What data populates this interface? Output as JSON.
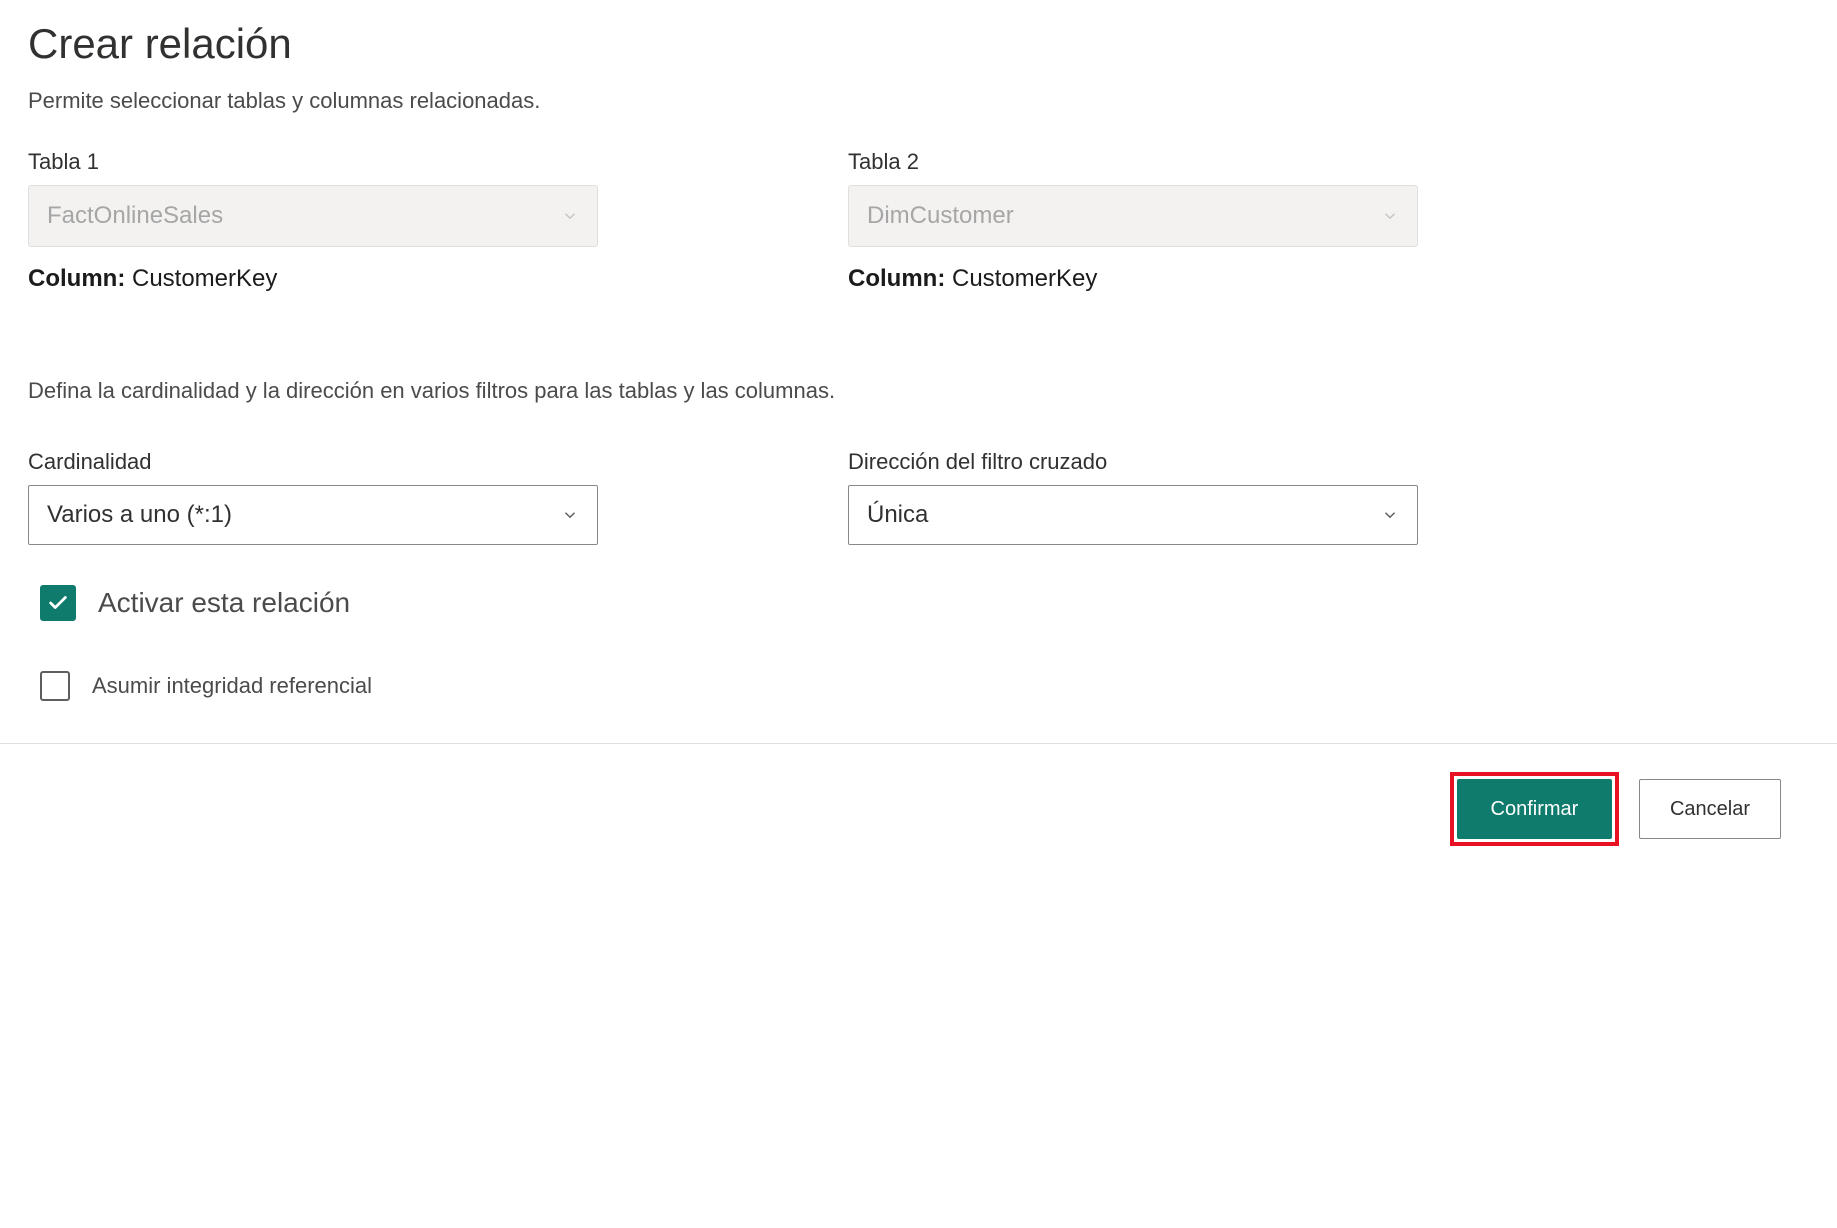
{
  "dialog": {
    "title": "Crear relación",
    "subtitle": "Permite seleccionar tablas y columnas relacionadas."
  },
  "table1": {
    "label": "Tabla 1",
    "value": "FactOnlineSales",
    "column_prefix": "Column: ",
    "column_value": "CustomerKey"
  },
  "table2": {
    "label": "Tabla 2",
    "value": "DimCustomer",
    "column_prefix": "Column: ",
    "column_value": "CustomerKey"
  },
  "cardinality_section": {
    "description": "Defina la cardinalidad y la dirección en varios filtros para las tablas y las columnas."
  },
  "cardinality": {
    "label": "Cardinalidad",
    "value": "Varios a uno (*:1)"
  },
  "cross_filter": {
    "label": "Dirección del filtro cruzado",
    "value": "Única"
  },
  "options": {
    "activate_label": "Activar esta relación",
    "assume_label": "Asumir integridad referencial"
  },
  "footer": {
    "confirm": "Confirmar",
    "cancel": "Cancelar"
  },
  "colors": {
    "primary": "#0f7b6c",
    "highlight": "#e81123"
  }
}
